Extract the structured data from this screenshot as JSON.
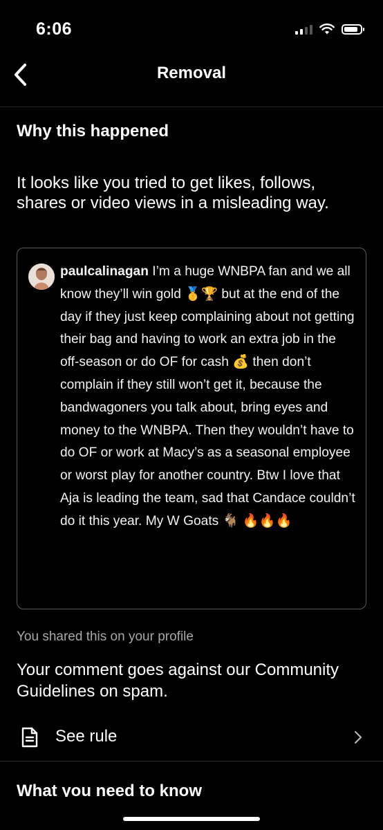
{
  "status_bar": {
    "time": "6:06",
    "icons": [
      "cellular-signal-icon",
      "wifi-icon",
      "battery-icon"
    ],
    "signal_bars_active": 2,
    "battery_level": 0.85
  },
  "nav": {
    "title": "Removal",
    "back_icon": "chevron-left-icon"
  },
  "why": {
    "title": "Why this happened",
    "reason": "It looks like you tried to get likes, follows, shares or video views in a misleading way."
  },
  "comment": {
    "username": "paulcalinagan",
    "text": " I’m a huge WNBPA fan and we all know they’ll win gold 🥇🏆 but at the end of the day if they just keep complaining about not getting their bag and having to work an extra job in the off-season or do OF for cash 💰 then don’t complain if they still won’t get it, because the bandwagoners you talk about, bring eyes and money to the WNBPA.  Then they wouldn’t have to do OF or work at Macy’s as a seasonal employee or worst play for another country. Btw I love that Aja is leading the team, sad that Candace couldn’t do it this year.  My W Goats 🐐 🔥🔥🔥"
  },
  "shared_note": "You shared this on your profile",
  "guideline": "Your comment goes against our Community Guidelines on spam.",
  "rule": {
    "label": "See rule",
    "icon": "document-icon",
    "chevron": "chevron-right-icon"
  },
  "next_section_title": "What you need to know",
  "colors": {
    "background": "#000000",
    "text": "#ffffff",
    "muted": "#a8a8a8",
    "card_border": "#5a5a5a",
    "divider": "#262626"
  }
}
